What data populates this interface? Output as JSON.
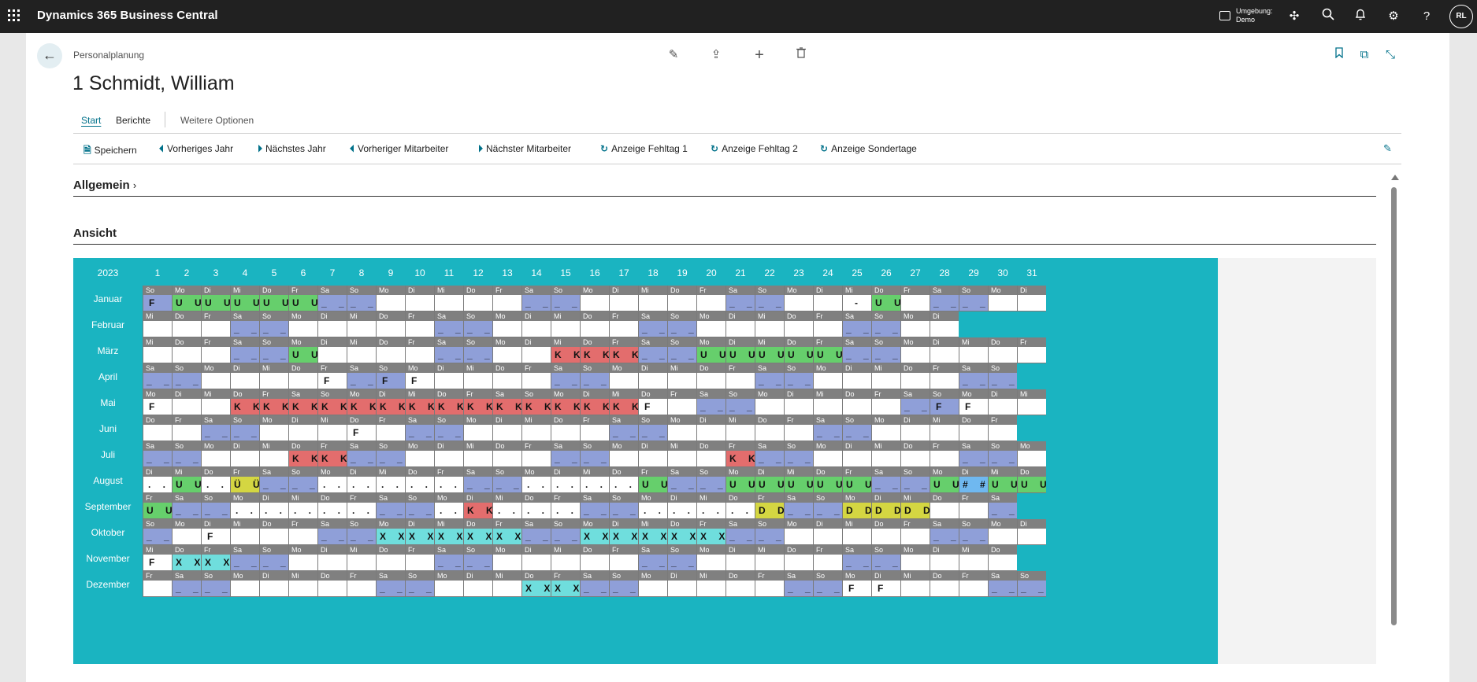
{
  "app": {
    "title": "Dynamics 365 Business Central",
    "env_label": "Umgebung:",
    "env_value": "Demo",
    "user_initials": "RL"
  },
  "record": {
    "breadcrumb": "Personalplanung",
    "title": "1 Schmidt, William"
  },
  "tabs": [
    "Start",
    "Berichte",
    "Weitere Optionen"
  ],
  "actions": [
    "Speichern",
    "Vorheriges Jahr",
    "Nächstes Jahr",
    "Vorheriger Mitarbeiter",
    "Nächster Mitarbeiter",
    "Anzeige Fehltag 1",
    "Anzeige Fehltag 2",
    "Anzeige Sondertage"
  ],
  "sections": {
    "general": "Allgemein",
    "view": "Ansicht"
  },
  "colors": {
    "teal": "#1ab4c1",
    "weekend": "#8f9fd8",
    "green": "#66cf6c",
    "red": "#e36d6d",
    "yellow": "#d4d642",
    "cyan": "#6fdedd",
    "magenta": "#e069df",
    "sky": "#6fb8f0"
  },
  "calendar": {
    "year": "2023",
    "days": [
      "1",
      "2",
      "3",
      "4",
      "5",
      "6",
      "7",
      "8",
      "9",
      "10",
      "11",
      "12",
      "13",
      "14",
      "15",
      "16",
      "17",
      "18",
      "19",
      "20",
      "21",
      "22",
      "23",
      "24",
      "25",
      "26",
      "27",
      "28",
      "29",
      "30",
      "31"
    ],
    "months": [
      {
        "name": "Januar",
        "start": 0,
        "len": 31,
        "marks": {
          "1": "F",
          "2": "U",
          "3": "U",
          "4": "U",
          "5": "U",
          "6": "U",
          "7": "_",
          "8": "_",
          "14": "_",
          "15": "_",
          "21": "_",
          "22": "_",
          "25": "-",
          "26": "U",
          "28": "_",
          "29": "_"
        }
      },
      {
        "name": "Februar",
        "start": 3,
        "len": 28,
        "marks": {
          "4": "_",
          "5": "_",
          "11": "_",
          "12": "_",
          "18": "_",
          "19": "_",
          "25": "_",
          "26": "_"
        }
      },
      {
        "name": "März",
        "start": 3,
        "len": 31,
        "marks": {
          "4": "_",
          "5": "_",
          "6": "U",
          "11": "_",
          "12": "_",
          "15": "K",
          "16": "K",
          "17": "K",
          "18": "_",
          "19": "_",
          "20": "U",
          "21": "U",
          "22": "U",
          "23": "U",
          "24": "U",
          "25": "_",
          "26": "_"
        }
      },
      {
        "name": "April",
        "start": 6,
        "len": 30,
        "marks": {
          "1": "_",
          "2": "_",
          "7": "F",
          "8": "_",
          "9": "F",
          "10": "F",
          "15": "_",
          "16": "_",
          "22": "_",
          "23": "_",
          "29": "_",
          "30": "_"
        },
        "dots": {}
      },
      {
        "name": "Mai",
        "start": 1,
        "len": 31,
        "marks": {
          "1": "F",
          "4": "K",
          "5": "K",
          "6": "K",
          "7": "K",
          "8": "K",
          "9": "K",
          "10": "K",
          "11": "K",
          "12": "K",
          "13": "K",
          "14": "K",
          "15": "K",
          "16": "K",
          "17": "K",
          "18": "F",
          "20": "_",
          "21": "_",
          "27": "_",
          "28": "F",
          "29": "F"
        }
      },
      {
        "name": "Juni",
        "start": 4,
        "len": 30,
        "marks": {
          "3": "_",
          "4": "_",
          "8": "F",
          "10": "_",
          "11": "_",
          "17": "_",
          "18": "_",
          "24": "_",
          "25": "_"
        }
      },
      {
        "name": "Juli",
        "start": 6,
        "len": 31,
        "marks": {
          "1": "_",
          "2": "_",
          "6": "K",
          "7": "K",
          "8": "_",
          "9": "_",
          "15": "_",
          "16": "_",
          "21": "K",
          "22": "_",
          "23": "_",
          "29": "_",
          "30": "_"
        }
      },
      {
        "name": "August",
        "start": 2,
        "len": 31,
        "marks": {
          "1": "..",
          "2": "U",
          "3": "..",
          "4": "ÜÜ",
          "5": "_",
          "6": "_",
          "7": "..",
          "8": "..",
          "9": "..",
          "10": "..",
          "11": "..",
          "12": "_",
          "13": "_",
          "14": "..",
          "15": "..",
          "16": "..",
          "17": "..",
          "18": "U",
          "19": "_",
          "20": "_",
          "21": "U",
          "22": "U",
          "23": "U",
          "24": "U",
          "25": "U",
          "26": "_",
          "27": "_",
          "28": "U",
          "29": "##",
          "30": "U",
          "31": "U"
        }
      },
      {
        "name": "September",
        "start": 5,
        "len": 30,
        "marks": {
          "1": "U",
          "2": "_",
          "3": "_",
          "4": "..",
          "5": "..",
          "6": "..",
          "7": "..",
          "8": "..",
          "9": "_",
          "10": "_",
          "11": "..",
          "12": "K",
          "13": "..",
          "14": "..",
          "15": "..",
          "16": "_",
          "17": "_",
          "18": "..",
          "19": "..",
          "20": "..",
          "21": "..",
          "22": "D",
          "23": "_",
          "24": "_",
          "25": "D",
          "26": "D",
          "27": "D",
          "30": "_"
        }
      },
      {
        "name": "Oktober",
        "start": 0,
        "len": 31,
        "marks": {
          "1": "_",
          "3": "F",
          "7": "_",
          "8": "_",
          "9": "X",
          "10": "X",
          "11": "X",
          "12": "X",
          "13": "X",
          "14": "_",
          "15": "_",
          "16": "X",
          "17": "X",
          "18": "X",
          "19": "X",
          "20": "X",
          "21": "_",
          "22": "_",
          "28": "_",
          "29": "_"
        }
      },
      {
        "name": "November",
        "start": 3,
        "len": 30,
        "marks": {
          "1": "F",
          "2": "X",
          "3": "X",
          "4": "_",
          "5": "_",
          "11": "_",
          "12": "_",
          "18": "_",
          "19": "_",
          "25": "_",
          "26": "_"
        }
      },
      {
        "name": "Dezember",
        "start": 5,
        "len": 31,
        "marks": {
          "2": "_",
          "3": "_",
          "9": "_",
          "10": "_",
          "14": "X",
          "15": "X",
          "16": "_",
          "17": "_",
          "23": "_",
          "24": "_",
          "25": "F",
          "26": "F",
          "30": "_",
          "31": "_"
        }
      }
    ]
  }
}
